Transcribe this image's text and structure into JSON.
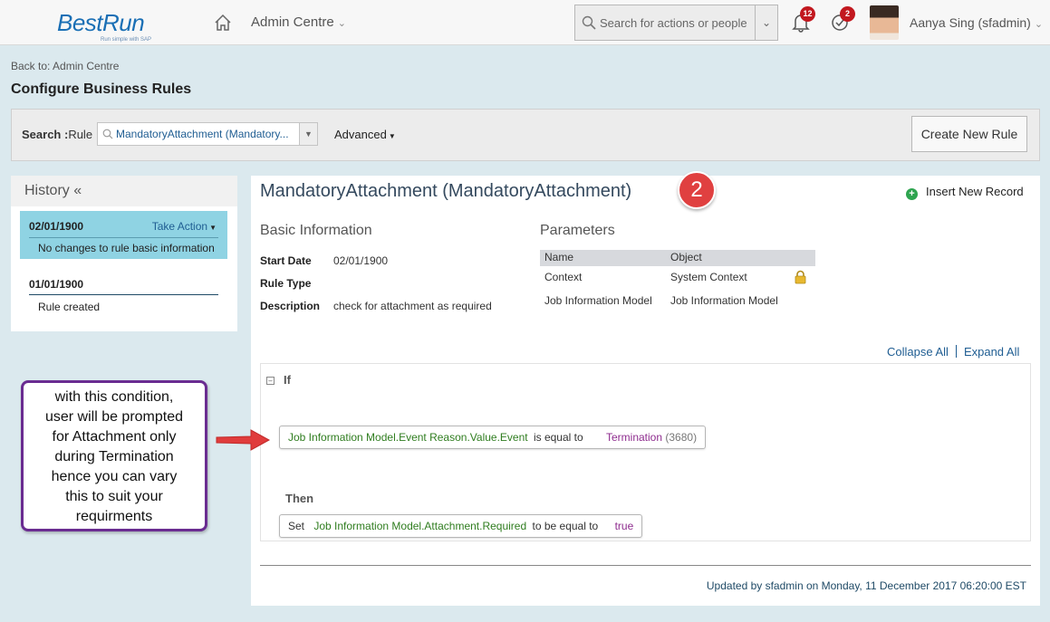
{
  "header": {
    "logo_text": "BestRun",
    "logo_tagline": "Run simple with SAP",
    "nav_label": "Admin Centre",
    "search_placeholder": "Search for actions or people",
    "notifications_count": "12",
    "todo_count": "2",
    "user_name": "Aanya Sing (sfadmin)"
  },
  "breadcrumb": {
    "back_link": "Back to: Admin Centre"
  },
  "page_title": "Configure Business Rules",
  "search_panel": {
    "label_bold": "Search :",
    "label_rest": "Rule",
    "rule_value": "MandatoryAttachment (Mandatory...",
    "advanced_label": "Advanced",
    "create_button": "Create New Rule"
  },
  "history": {
    "title": "History «",
    "items": [
      {
        "date": "02/01/1900",
        "action": "Take Action",
        "description": "No changes to rule basic information"
      },
      {
        "date": "01/01/1900",
        "description": "Rule created"
      }
    ]
  },
  "main": {
    "rule_title": "MandatoryAttachment (MandatoryAttachment)",
    "step_number": "2",
    "insert_record": "Insert New Record",
    "basic_info": {
      "heading": "Basic Information",
      "rows": [
        {
          "label": "Start Date",
          "value": "02/01/1900"
        },
        {
          "label": "Rule Type",
          "value": ""
        },
        {
          "label": "Description",
          "value": "check for attachment as required"
        }
      ]
    },
    "parameters": {
      "heading": "Parameters",
      "columns": [
        "Name",
        "Object"
      ],
      "rows": [
        {
          "name": "Context",
          "object": "System Context"
        },
        {
          "name": "Job Information Model",
          "object": "Job Information Model"
        }
      ]
    },
    "collapse_all": "Collapse All",
    "expand_all": "Expand All",
    "if_label": "If",
    "condition": {
      "field": "Job Information Model.Event Reason.Value.Event",
      "operator": "is equal to",
      "value": "Termination",
      "code": "(3680)"
    },
    "then_label": "Then",
    "action": {
      "verb": "Set",
      "field": "Job Information Model.Attachment.Required",
      "operator": "to be equal to",
      "value": "true"
    },
    "updated": "Updated by sfadmin on Monday, 11 December 2017 06:20:00 EST"
  },
  "callout": {
    "lines": [
      "with this condition,",
      "user will be prompted",
      "for Attachment only",
      "during Termination",
      "hence you can vary",
      "this to suit your",
      "requirments"
    ]
  },
  "colors": {
    "accent_red": "#e04040",
    "callout_border": "#6a2c91",
    "history_selected": "#8fd3e3",
    "field_green": "#2f7d1f",
    "value_purple": "#8e2c8e"
  }
}
